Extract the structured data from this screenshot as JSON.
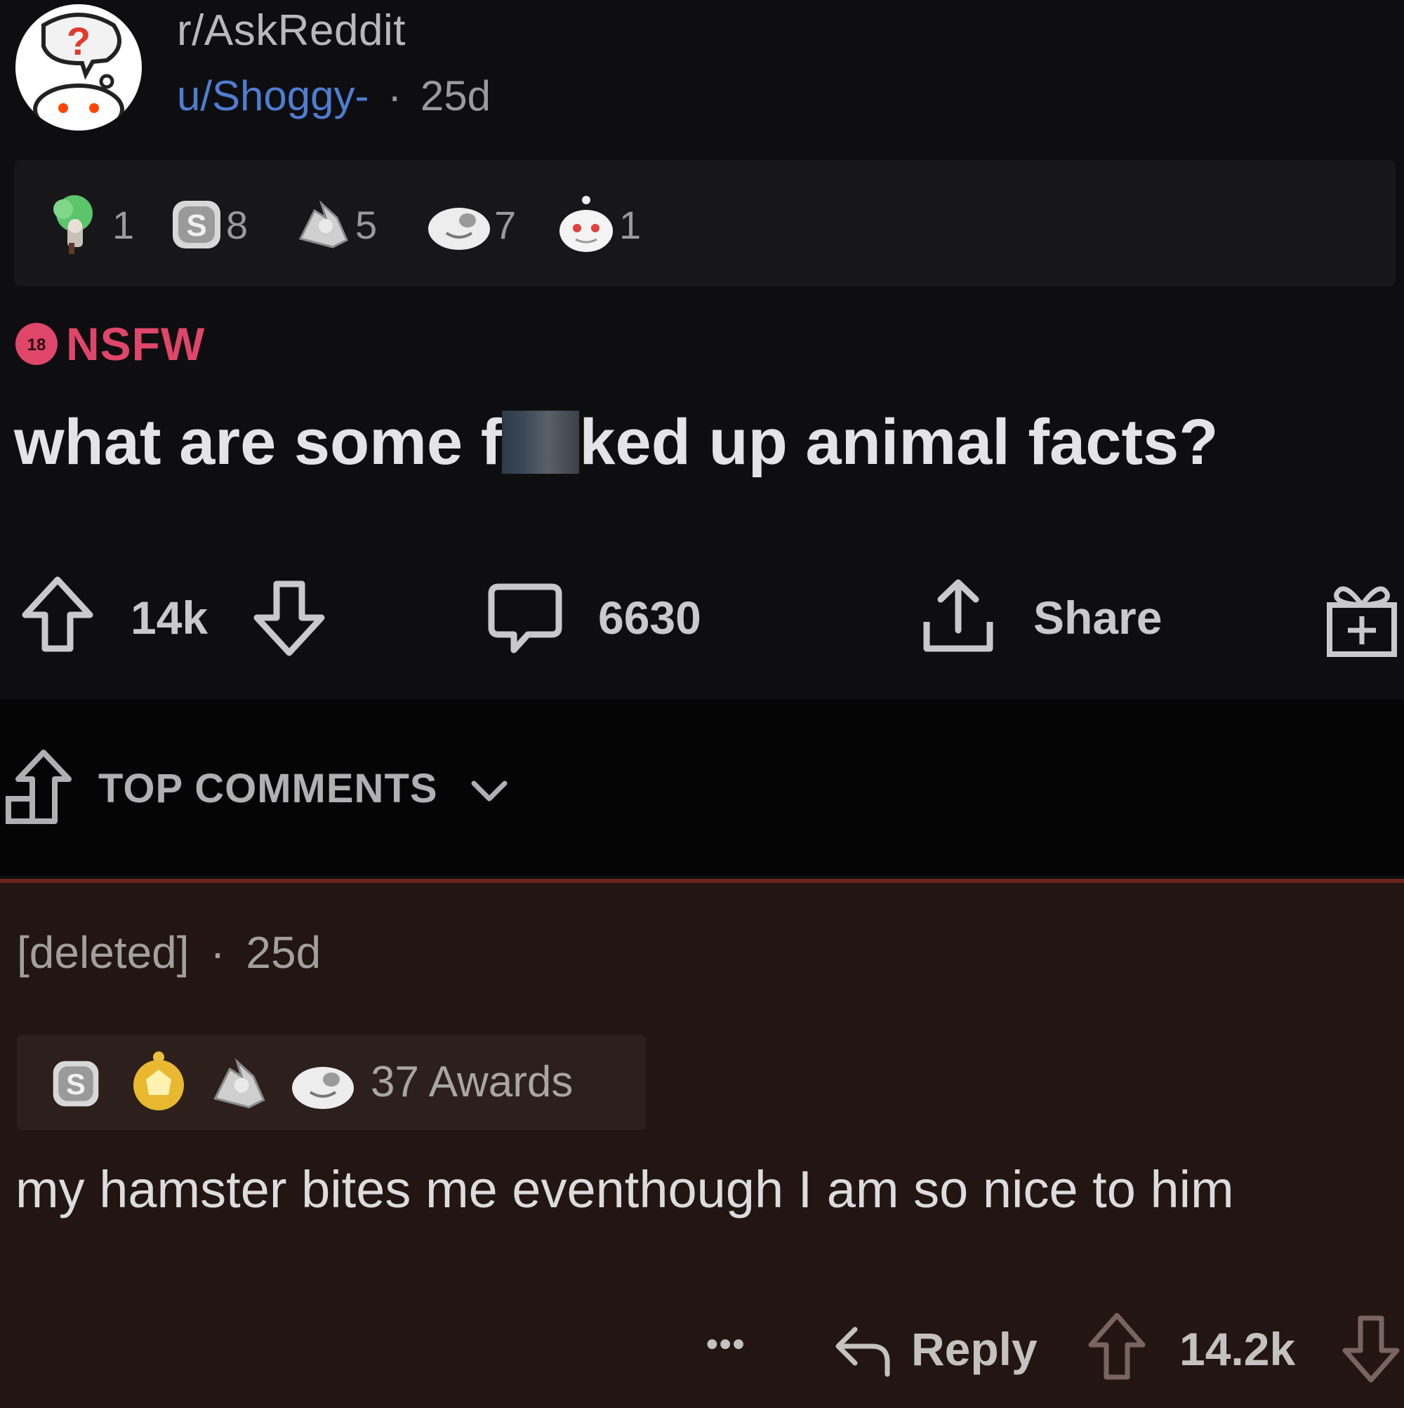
{
  "post": {
    "subreddit": "r/AskReddit",
    "author": "u/Shoggy-",
    "separator": "·",
    "age": "25d",
    "nsfw_badge_number": "18",
    "nsfw_label": "NSFW",
    "title_before": "what are some f",
    "title_after": "ked up animal facts?",
    "awards": [
      {
        "icon": "helping-hand-award-icon",
        "count": "1"
      },
      {
        "icon": "silver-award-icon",
        "count": "8"
      },
      {
        "icon": "wholesome-award-icon",
        "count": "5"
      },
      {
        "icon": "snoo-laugh-award-icon",
        "count": "7"
      },
      {
        "icon": "snoo-cake-award-icon",
        "count": "1"
      }
    ],
    "upvotes": "14k",
    "comments": "6630",
    "share_label": "Share"
  },
  "comments_header": {
    "sort_label": "TOP COMMENTS"
  },
  "comment": {
    "author": "[deleted]",
    "separator": "·",
    "age": "25d",
    "award_icons": [
      "silver-award-icon",
      "gold-award-icon",
      "wholesome-award-icon",
      "snoo-laugh-award-icon"
    ],
    "awards_label": "37 Awards",
    "body": "my hamster bites me eventhough I am so nice to him",
    "more_label": "•••",
    "reply_label": "Reply",
    "score": "14.2k"
  },
  "colors": {
    "background": "#0e0e10",
    "nsfw": "#e0466a",
    "user_link": "#4f7dd0",
    "comment_bg": "#221512",
    "comment_border": "#6a2418"
  }
}
